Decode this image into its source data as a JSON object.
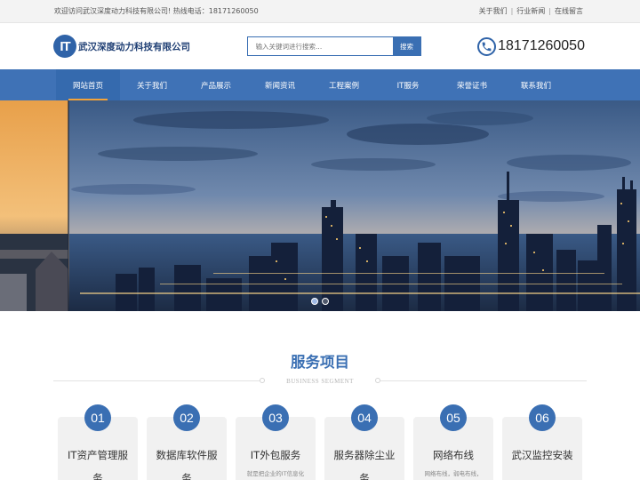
{
  "topbar": {
    "welcome": "欢迎访问武汉深度动力科技有限公司!  热线电话：18171260050",
    "links": [
      "关于我们",
      "行业新闻",
      "在线留言"
    ]
  },
  "header": {
    "logo_badge": "IT",
    "company": "武汉深度动力科技有限公司",
    "search_placeholder": "输入关键词进行搜索...",
    "search_button": "搜索",
    "hotline": "18171260050"
  },
  "nav": {
    "items": [
      "网站首页",
      "关于我们",
      "产品展示",
      "新闻资讯",
      "工程案例",
      "IT服务",
      "荣誉证书",
      "联系我们"
    ],
    "active_index": 0
  },
  "banner": {
    "slide_count": 2,
    "active_slide": 0
  },
  "services": {
    "title": "服务项目",
    "subtitle": "BUSINESS SEGMENT",
    "items": [
      {
        "num": "01",
        "title": "IT资产管理服务",
        "desc": ""
      },
      {
        "num": "02",
        "title": "数据库软件服务",
        "desc": ""
      },
      {
        "num": "03",
        "title": "IT外包服务",
        "desc": "就是把企业的IT信息化"
      },
      {
        "num": "04",
        "title": "服务器除尘业务",
        "desc": ""
      },
      {
        "num": "05",
        "title": "网络布线",
        "desc": "网络布线，弱电布线，"
      },
      {
        "num": "06",
        "title": "武汉监控安装",
        "desc": ""
      }
    ]
  },
  "colors": {
    "brand_blue": "#3f72b6",
    "nav_active_underline": "#f3a33a",
    "logo_text": "#1f3f74"
  }
}
